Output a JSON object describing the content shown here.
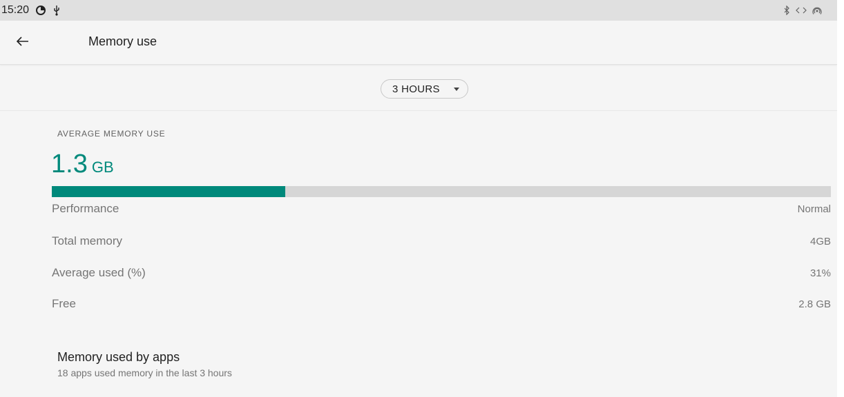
{
  "status_bar": {
    "time": "15:20",
    "icons_left": [
      "data-saver-icon",
      "usb-icon"
    ],
    "icons_right": [
      "bluetooth-icon",
      "code-icon",
      "hotspot-icon"
    ]
  },
  "app_bar": {
    "title": "Memory use",
    "back_icon": "arrow-back-icon"
  },
  "range_selector": {
    "selected": "3 HOURS"
  },
  "summary": {
    "label": "AVERAGE MEMORY USE",
    "value": "1.3",
    "unit": "GB",
    "usage_fraction": 0.3,
    "accent_color": "#00897b",
    "track_color": "#d6d6d6"
  },
  "stats": [
    {
      "name": "Performance",
      "value": "Normal"
    },
    {
      "name": "Total memory",
      "value": "4GB"
    },
    {
      "name": "Average used (%)",
      "value": "31%"
    },
    {
      "name": "Free",
      "value": "2.8 GB"
    }
  ],
  "apps": {
    "title": "Memory used by apps",
    "subtitle": "18 apps used memory in the last 3 hours"
  }
}
